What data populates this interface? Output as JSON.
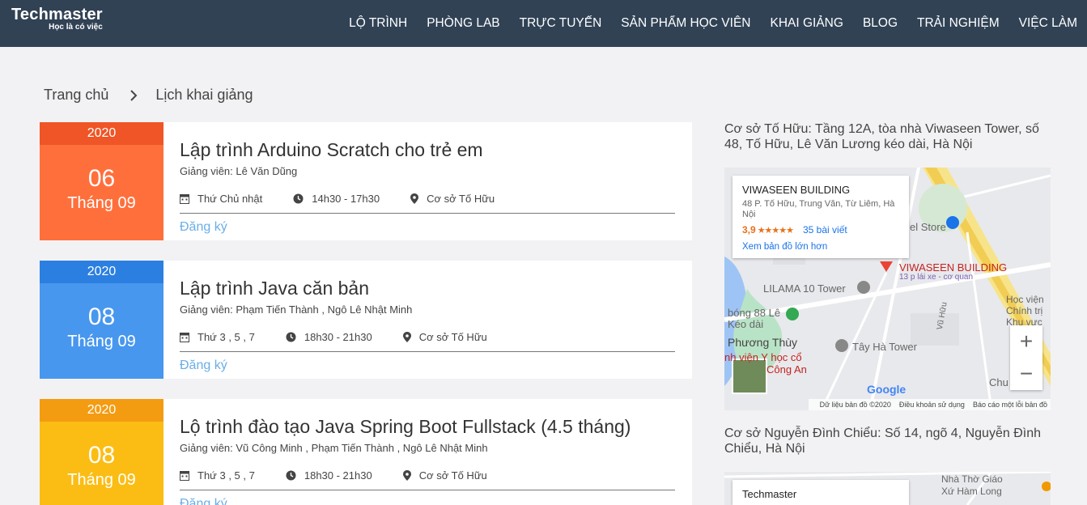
{
  "header": {
    "brand": "Techmaster",
    "tagline": "Học là có việc",
    "nav": [
      "LỘ TRÌNH",
      "PHÒNG LAB",
      "TRỰC TUYẾN",
      "SẢN PHẨM HỌC VIÊN",
      "KHAI GIẢNG",
      "BLOG",
      "TRẢI NGHIỆM",
      "VIỆC LÀM"
    ]
  },
  "breadcrumb": {
    "home": "Trang chủ",
    "current": "Lịch khai giảng"
  },
  "courses": [
    {
      "year": "2020",
      "day": "06",
      "month": "Tháng 09",
      "title": "Lập trình Arduino Scratch cho trẻ em",
      "teacher": "Giảng viên: Lê Văn Dũng",
      "schedule": "Thứ Chủ nhật",
      "time": "14h30 - 17h30",
      "location": "Cơ sở Tố Hữu",
      "register": "Đăng ký",
      "color_top": "#ef5526",
      "color_main": "#ff6f3c"
    },
    {
      "year": "2020",
      "day": "08",
      "month": "Tháng 09",
      "title": "Lập trình Java căn bản",
      "teacher": "Giảng viên: Phạm Tiến Thành , Ngô Lê Nhật Minh",
      "schedule": "Thứ 3 , 5 , 7",
      "time": "18h30 - 21h30",
      "location": "Cơ sở Tố Hữu",
      "register": "Đăng ký",
      "color_top": "#2b7fe0",
      "color_main": "#4897ee"
    },
    {
      "year": "2020",
      "day": "08",
      "month": "Tháng 09",
      "title": "Lộ trình đào tạo Java Spring Boot Fullstack (4.5 tháng)",
      "teacher": "Giảng viên: Vũ Công Minh , Phạm Tiến Thành , Ngô Lê Nhật Minh",
      "schedule": "Thứ 3 , 5 , 7",
      "time": "18h30 - 21h30",
      "location": "Cơ sở Tố Hữu",
      "register": "Đăng ký",
      "color_top": "#f39c12",
      "color_main": "#fbbd14"
    }
  ],
  "sidebar": {
    "campus1": "Cơ sở Tố Hữu: Tầng 12A, tòa nhà Viwaseen Tower, số 48, Tố Hữu, Lê Văn Lương kéo dài, Hà Nội",
    "map1": {
      "place_name": "VIWASEEN BUILDING",
      "place_address": "48 P. Tố Hữu, Trung Văn, Từ Liêm, Hà Nội",
      "rating": "3,9",
      "stars": "★★★★★",
      "reviews": "35 bài viết",
      "larger_map": "Xem bản đồ lớn hơn",
      "labels": [
        "VIWASEEN BUILDING",
        "13 p lái xe - cơ quan",
        "LILAMA 10 Tower",
        "el Store",
        "bóng 88 Lê",
        "Kéo dài",
        "Phương Thùy",
        "Tây Hà Tower",
        "nh viện Y học cổ",
        "Công An",
        "Học viện",
        "Chính trị",
        "Khu vực",
        "Vũ Hữu",
        "Chu"
      ],
      "google": "Google",
      "footer": [
        "Dữ liệu bản đồ ©2020",
        "Điều khoản sử dụng",
        "Báo cáo một lỗi bản đồ"
      ]
    },
    "campus2": "Cơ sở Nguyễn Đình Chiểu: Số 14, ngõ 4, Nguyễn Đình Chiểu, Hà Nội",
    "map2": {
      "place_name": "Techmaster",
      "labels": [
        "Nhà Thờ Giáo",
        "Xứ Hàm Long"
      ]
    }
  }
}
